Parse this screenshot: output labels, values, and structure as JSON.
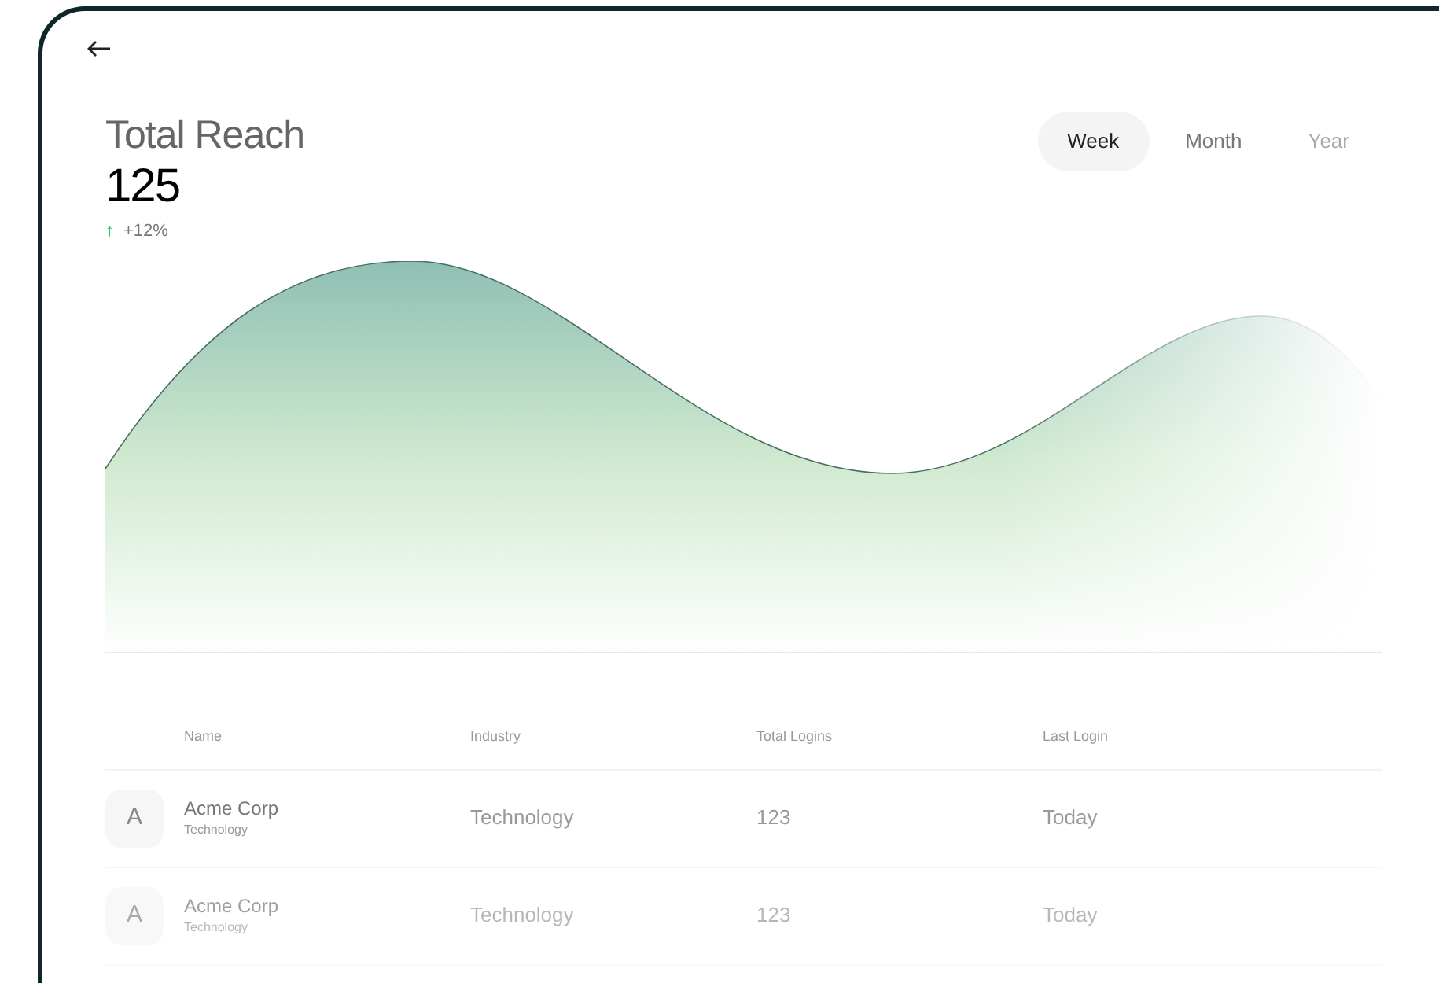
{
  "header": {
    "title": "Total Reach",
    "value": "125",
    "change": {
      "arrow": "↑",
      "text": "+12%"
    }
  },
  "tabs": [
    {
      "label": "Week",
      "selected": true
    },
    {
      "label": "Month",
      "selected": false
    },
    {
      "label": "Year",
      "selected": false,
      "faded": true
    }
  ],
  "table": {
    "columns": [
      "Name",
      "Industry",
      "Total Logins",
      "Last Login"
    ],
    "rows": [
      {
        "initial": "A",
        "name": "Acme Corp",
        "subtitle": "Technology",
        "industry": "Technology",
        "logins": "123",
        "last_login": "Today",
        "faded": false
      },
      {
        "initial": "A",
        "name": "Acme Corp",
        "subtitle": "Technology",
        "industry": "Technology",
        "logins": "123",
        "last_login": "Today",
        "faded": true
      }
    ]
  }
}
